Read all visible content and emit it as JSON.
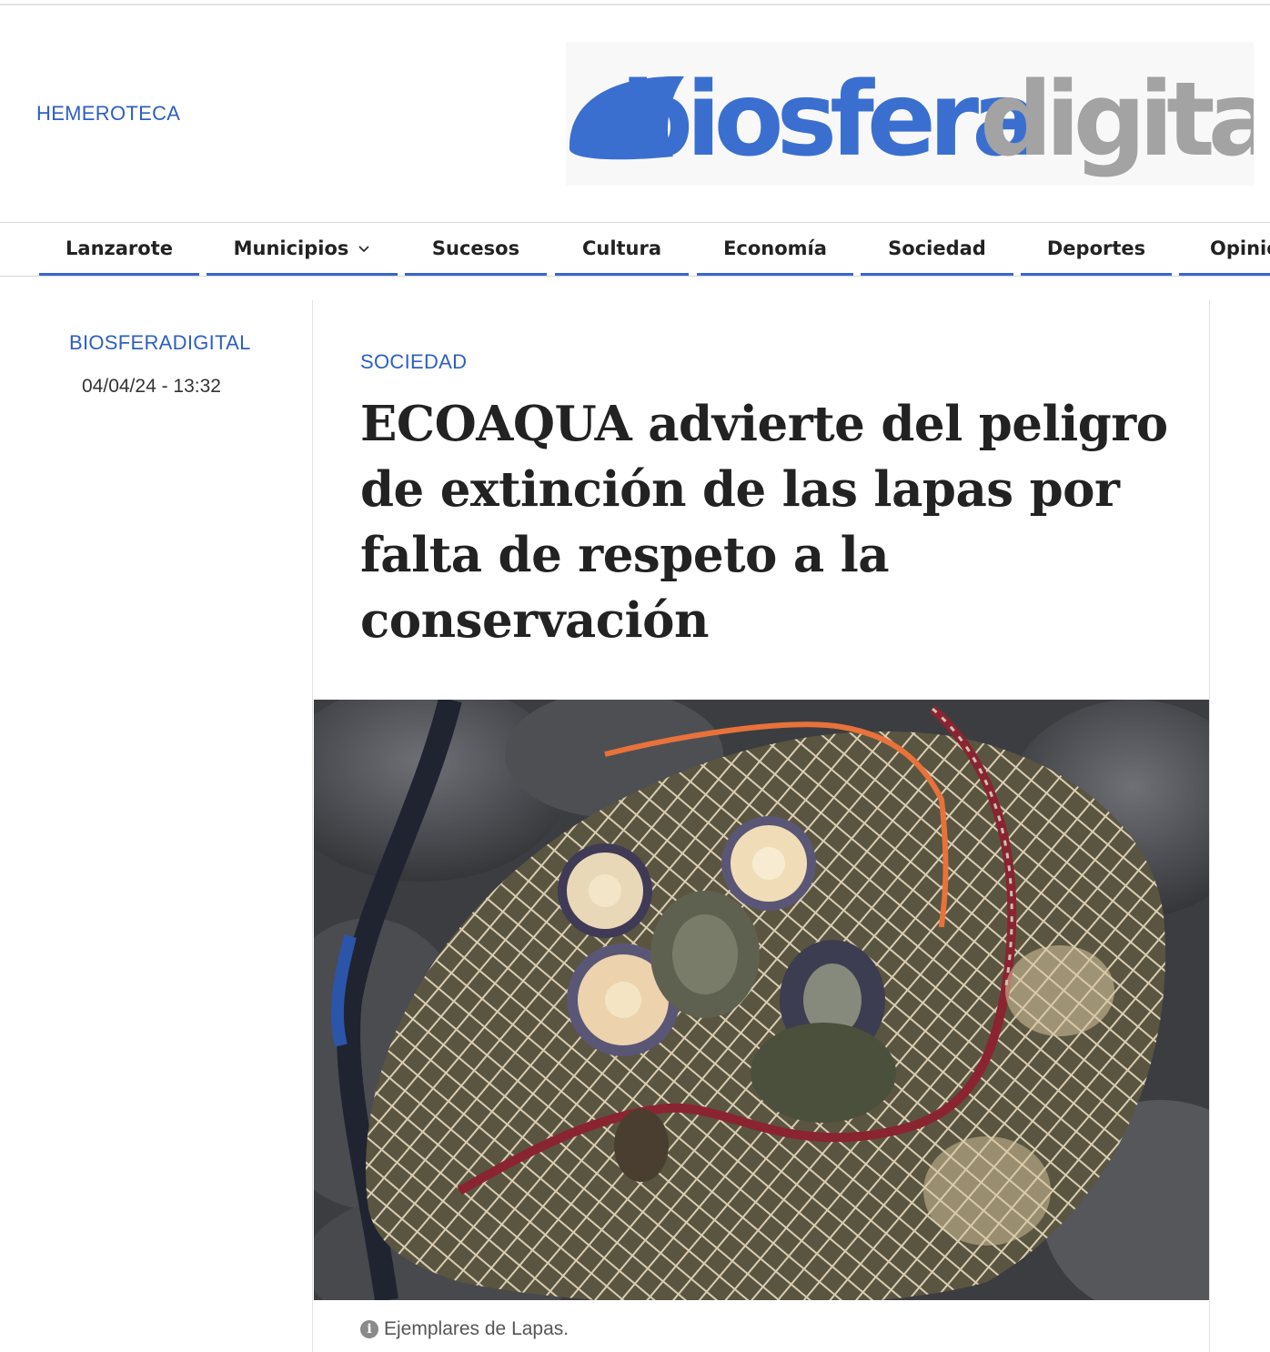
{
  "header": {
    "hemeroteca_label": "HEMEROTECA",
    "logo": {
      "part1": "biosfera",
      "part2": "digital",
      "part1_color": "#3a6fd0",
      "part2_color": "#a3a3a3"
    }
  },
  "nav": {
    "accent_color": "#3a66cc",
    "items": [
      {
        "label": "Lanzarote"
      },
      {
        "label": "Municipios",
        "has_dropdown": true
      },
      {
        "label": "Sucesos"
      },
      {
        "label": "Cultura"
      },
      {
        "label": "Economía"
      },
      {
        "label": "Sociedad"
      },
      {
        "label": "Deportes"
      },
      {
        "label": "Opinió"
      }
    ]
  },
  "article": {
    "author": "BIOSFERADIGITAL",
    "date": "04/04/24 - 13:32",
    "section": "SOCIEDAD",
    "headline": "ECOAQUA advierte del peligro de extinción de las lapas por falta de respeto a la conservación",
    "image": {
      "description_icon": "info-icon",
      "caption": "Ejemplares de Lapas."
    }
  },
  "colors": {
    "link_blue": "#2d5fc2",
    "text": "#222222"
  }
}
